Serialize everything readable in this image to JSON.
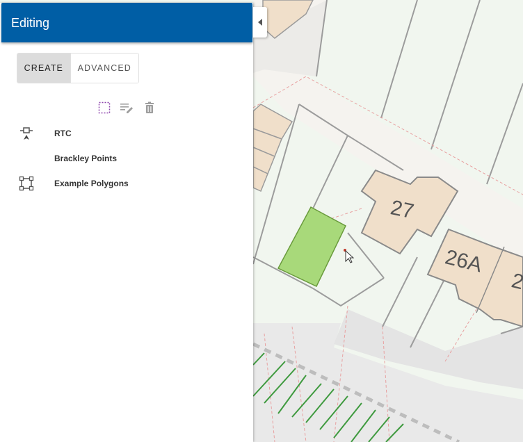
{
  "panel": {
    "title": "Editing",
    "tabs": [
      {
        "label": "CREATE",
        "active": true
      },
      {
        "label": "ADVANCED",
        "active": false
      }
    ],
    "toolbar": [
      {
        "icon": "select-rectangle-icon"
      },
      {
        "icon": "edit-attributes-icon"
      },
      {
        "icon": "delete-icon"
      }
    ],
    "layers": [
      {
        "label": "RTC",
        "icon": "point-feature-icon"
      },
      {
        "label": "Brackley Points",
        "icon": ""
      },
      {
        "label": "Example Polygons",
        "icon": "polygon-feature-icon"
      }
    ]
  },
  "map": {
    "building_labels": [
      "27",
      "26A",
      "2"
    ],
    "colors": {
      "background": "#f1f6ef",
      "road": "#e7e7e7",
      "building_fill": "#f0dfca",
      "building_stroke": "#8a8a8a",
      "selected_parcel": "#a8d97a",
      "selected_parcel_stroke": "#6a9b3d",
      "hatch": "#3f9a3f",
      "header": "#005ea5"
    }
  }
}
